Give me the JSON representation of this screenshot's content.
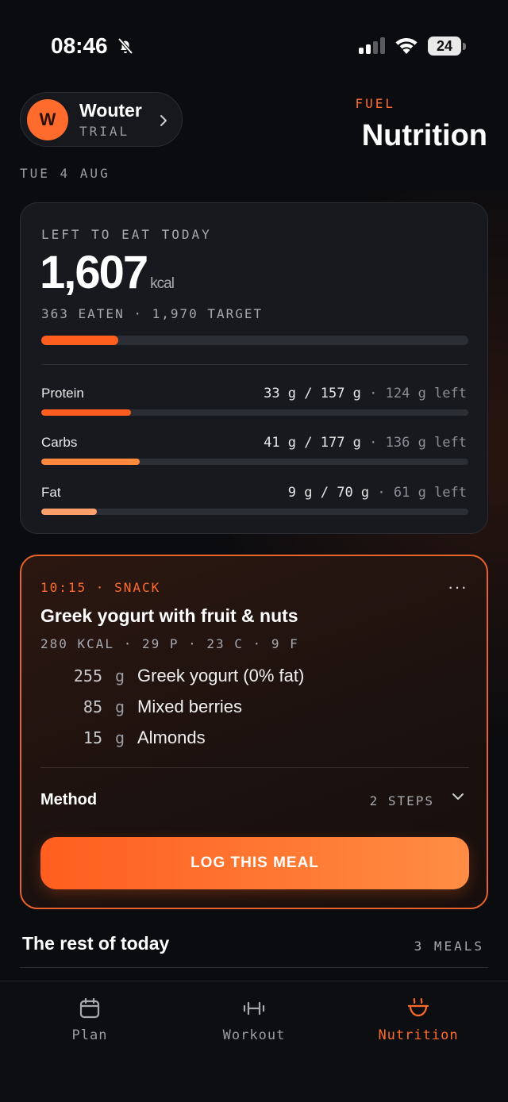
{
  "status_bar": {
    "time": "08:46",
    "battery": "24"
  },
  "header": {
    "user_initial": "W",
    "user_name": "Wouter",
    "user_plan": "TRIAL",
    "section_kicker": "FUEL",
    "page_title": "Nutrition",
    "date": "TUE 4 AUG"
  },
  "summary": {
    "label": "LEFT TO EAT TODAY",
    "kcal_left": "1,607",
    "kcal_unit": "kcal",
    "eaten_line": "363 EATEN · 1,970 TARGET",
    "calorie_progress": 0.18,
    "macros": [
      {
        "name": "Protein",
        "amount": "33 g / 157 g",
        "left": "· 124 g left",
        "progress": 0.21,
        "color": "#ff5e1f"
      },
      {
        "name": "Carbs",
        "amount": "41 g / 177 g",
        "left": "· 136 g left",
        "progress": 0.23,
        "color": "#ff8a3d"
      },
      {
        "name": "Fat",
        "amount": "9 g / 70 g",
        "left": "· 61 g left",
        "progress": 0.13,
        "color": "#ffa06b"
      }
    ]
  },
  "meal": {
    "meta": "10:15 · SNACK",
    "more": "···",
    "title": "Greek yogurt with fruit & nuts",
    "macros": "280 KCAL · 29 P · 23 C · 9 F",
    "ingredients": [
      {
        "qty": "255",
        "unit": "g",
        "name": "Greek yogurt (0% fat)"
      },
      {
        "qty": "85",
        "unit": "g",
        "name": "Mixed berries"
      },
      {
        "qty": "15",
        "unit": "g",
        "name": "Almonds"
      }
    ],
    "method_label": "Method",
    "method_steps": "2 STEPS",
    "log_button": "LOG THIS MEAL"
  },
  "rest_of_today": {
    "title": "The rest of today",
    "count": "3 MEALS"
  },
  "tab_bar": {
    "tabs": [
      {
        "label": "Plan",
        "icon": "calendar-icon",
        "active": false
      },
      {
        "label": "Workout",
        "icon": "dumbbell-icon",
        "active": false
      },
      {
        "label": "Nutrition",
        "icon": "bowl-icon",
        "active": true
      }
    ]
  },
  "colors": {
    "accent": "#ff6b2c",
    "background": "#0b0c0f",
    "card": "#17191e",
    "track": "#2b2e35"
  }
}
